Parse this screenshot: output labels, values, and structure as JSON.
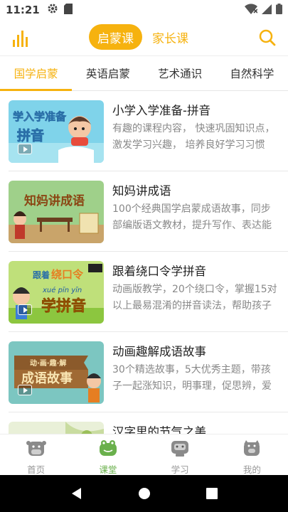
{
  "status_bar": {
    "time": "11:21"
  },
  "header": {
    "segments": [
      "启蒙课",
      "家长课"
    ],
    "active_segment": 0,
    "accent": "#f6b20f"
  },
  "tabs": [
    "国学启蒙",
    "英语启蒙",
    "艺术通识",
    "自然科学"
  ],
  "courses": [
    {
      "title": "小学入学准备-拼音",
      "desc": "有趣的课程内容， 快速巩固知识点，激发学习兴趣， 培养良好学习习惯",
      "thumb": {
        "line1": "学入学准备",
        "line2": "拼音"
      }
    },
    {
      "title": "知妈讲成语",
      "desc": "100个经典国学启蒙成语故事，同步部编版语文教材，提升写作、表达能力",
      "thumb": {
        "line1": "知妈讲成语"
      }
    },
    {
      "title": "跟着绕口令学拼音",
      "desc": "动画版教学，20个绕口令，掌握15对以上最易混淆的拼音读法，帮助孩子",
      "thumb": {
        "line1": "跟着",
        "line2": "绕口令",
        "line3": "xué pīn yīn",
        "line4": "学拼音"
      }
    },
    {
      "title": "动画趣解成语故事",
      "desc": "30个精选故事，5大优秀主题，带孩子一起涨知识，明事理，促思辨，爱国学",
      "thumb": {
        "line1": "动·画·趣·解",
        "line2": "成语故事"
      }
    },
    {
      "title": "汉字里的节气之美",
      "desc": "",
      "thumb": {}
    }
  ],
  "bottom_nav": [
    "首页",
    "课堂",
    "学习",
    "我的"
  ],
  "active_nav": 1
}
